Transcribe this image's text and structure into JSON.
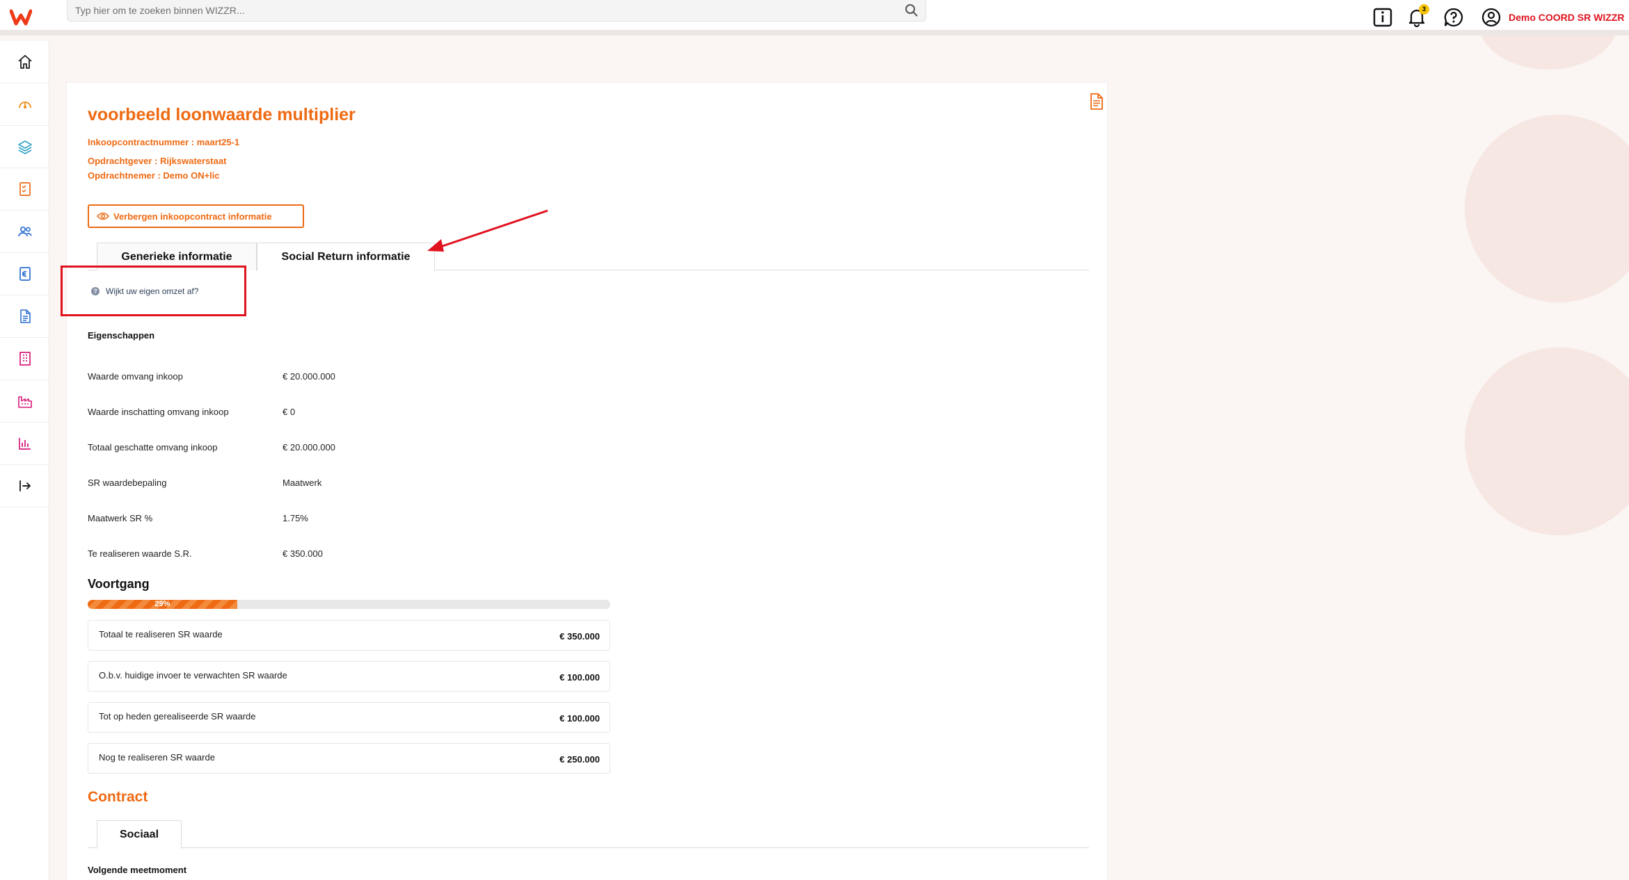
{
  "header": {
    "search_placeholder": "Typ hier om te zoeken binnen WIZZR...",
    "notification_count": "3",
    "user_name": "Demo COORD SR WIZZR"
  },
  "sidebar": {
    "items": [
      {
        "icon": "home-icon",
        "color": "#222222"
      },
      {
        "icon": "dashboard-gauge-icon",
        "color": "#ee8a13"
      },
      {
        "icon": "layers-icon",
        "color": "#33a3c8"
      },
      {
        "icon": "checklist-icon",
        "color": "#ee6a13"
      },
      {
        "icon": "users-icon",
        "color": "#2c6fd1"
      },
      {
        "icon": "euro-document-icon",
        "color": "#2c6fd1"
      },
      {
        "icon": "document-icon",
        "color": "#2c6fd1"
      },
      {
        "icon": "building-icon",
        "color": "#d9197a"
      },
      {
        "icon": "factory-icon",
        "color": "#d9197a"
      },
      {
        "icon": "bar-chart-icon",
        "color": "#d9197a"
      },
      {
        "icon": "logout-icon",
        "color": "#222222"
      }
    ]
  },
  "contract": {
    "title": "voorbeeld loonwaarde multiplier",
    "number": "Inkoopcontractnummer : maart25-1",
    "client": "Opdrachtgever : Rijkswaterstaat",
    "contractor": "Opdrachtnemer : Demo ON+lic",
    "toggle_button": "Verbergen inkoopcontract informatie"
  },
  "tabs": [
    {
      "label": "Generieke informatie",
      "active": false
    },
    {
      "label": "Social Return informatie",
      "active": true
    }
  ],
  "help_link": "Wijkt uw eigen omzet af?",
  "properties": {
    "heading": "Eigenschappen",
    "rows": [
      {
        "label": "Waarde omvang inkoop",
        "value": "€ 20.000.000"
      },
      {
        "label": "Waarde inschatting omvang inkoop",
        "value": "€ 0"
      },
      {
        "label": "Totaal geschatte omvang inkoop",
        "value": "€ 20.000.000"
      },
      {
        "label": "SR waardebepaling",
        "value": "Maatwerk"
      },
      {
        "label": "Maatwerk SR %",
        "value": "1.75%"
      },
      {
        "label": "Te realiseren waarde S.R.",
        "value": "€ 350.000"
      }
    ]
  },
  "progress": {
    "heading": "Voortgang",
    "percent_label": "29%",
    "fraction": 0.286,
    "stats": [
      {
        "label": "Totaal te realiseren SR waarde",
        "value": "€ 350.000"
      },
      {
        "label": "O.b.v. huidige invoer te verwachten SR waarde",
        "value": "€ 100.000"
      },
      {
        "label": "Tot op heden gerealiseerde SR waarde",
        "value": "€ 100.000"
      },
      {
        "label": "Nog te realiseren SR waarde",
        "value": "€ 250.000"
      }
    ]
  },
  "contract_section": {
    "heading": "Contract",
    "tab": "Sociaal",
    "next_heading": "Volgende meetmoment"
  },
  "colors": {
    "accent": "#ee6a13",
    "user": "#e0121e",
    "annotation": "#e0121e"
  }
}
